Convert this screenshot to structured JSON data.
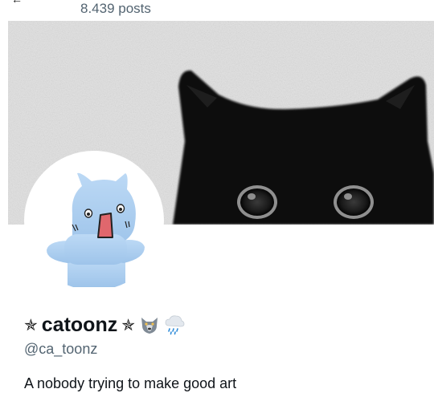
{
  "header": {
    "post_count": "8.439 posts"
  },
  "profile": {
    "display_name": "catoonz",
    "name_prefix_symbol": "✯",
    "name_suffix_symbol": "✯",
    "handle": "@ca_toonz",
    "bio": "A nobody trying to make good art"
  },
  "icons": {
    "back": "back-arrow-icon",
    "wolf_emoji": "wolf-emoji-icon",
    "rain_emoji": "rain-cloud-emoji-icon"
  },
  "colors": {
    "primary_text": "#0f1419",
    "secondary_text": "#536471",
    "banner_background": "#e6e6e6",
    "cat_black": "#0c0c0c",
    "avatar_cat_blue": "#a9cdf0"
  }
}
